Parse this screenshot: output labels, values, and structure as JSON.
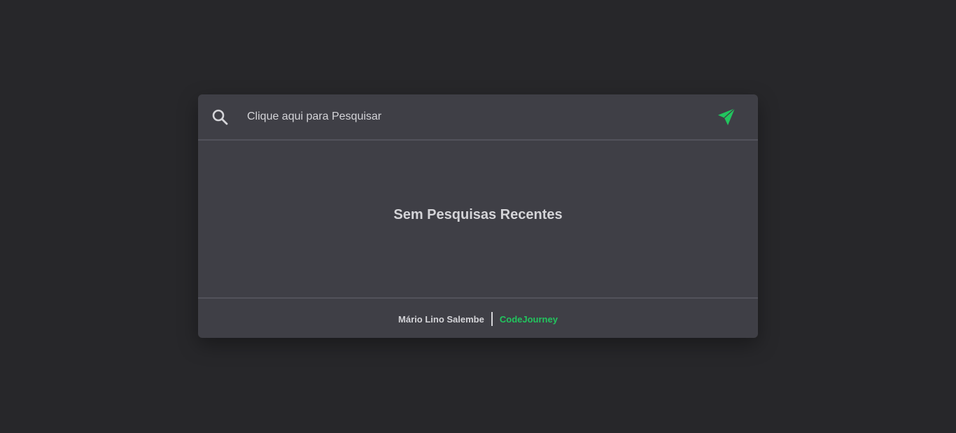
{
  "search": {
    "placeholder": "Clique aqui para Pesquisar",
    "value": ""
  },
  "icons": {
    "search": "search-icon",
    "send": "send-icon"
  },
  "main": {
    "empty_message": "Sem Pesquisas Recentes"
  },
  "footer": {
    "author": "Mário Lino Salembe",
    "brand": "CodeJourney"
  },
  "colors": {
    "background": "#27272a",
    "card": "#3f3f46",
    "text": "#d4d4d8",
    "accent": "#22c55e"
  }
}
